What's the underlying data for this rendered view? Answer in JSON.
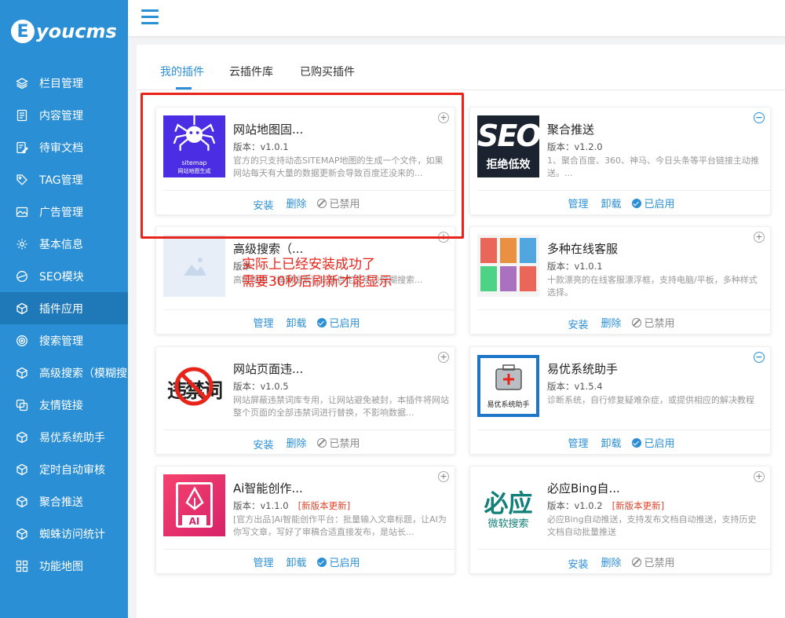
{
  "logo": {
    "letter": "E",
    "text": "youcms"
  },
  "sidebar": {
    "items": [
      {
        "label": "栏目管理",
        "icon": "layers-icon"
      },
      {
        "label": "内容管理",
        "icon": "document-icon"
      },
      {
        "label": "待审文档",
        "icon": "edit-document-icon"
      },
      {
        "label": "TAG管理",
        "icon": "tag-icon"
      },
      {
        "label": "广告管理",
        "icon": "image-icon"
      },
      {
        "label": "基本信息",
        "icon": "gear-icon"
      },
      {
        "label": "SEO模块",
        "icon": "globe-icon"
      },
      {
        "label": "插件应用",
        "icon": "cube-icon"
      },
      {
        "label": "搜索管理",
        "icon": "target-icon"
      },
      {
        "label": "高级搜索（模糊搜",
        "icon": "cube-icon"
      },
      {
        "label": "友情链接",
        "icon": "link-icon"
      },
      {
        "label": "易优系统助手",
        "icon": "cube-icon"
      },
      {
        "label": "定时自动审核",
        "icon": "cube-icon"
      },
      {
        "label": "聚合推送",
        "icon": "cube-icon"
      },
      {
        "label": "蜘蛛访问统计",
        "icon": "cube-icon"
      },
      {
        "label": "功能地图",
        "icon": "grid-icon"
      }
    ],
    "active_index": 7
  },
  "tabs": [
    "我的插件",
    "云插件库",
    "已购买插件"
  ],
  "labels": {
    "install": "安装",
    "delete": "删除",
    "disabled": "已禁用",
    "manage": "管理",
    "uninstall": "卸载",
    "enabled": "已启用"
  },
  "plugins": [
    {
      "name": "网站地图固...",
      "version": "版本：v1.0.1",
      "desc": "官方的只支持动态SITEMAP地图的生成一个文件，如果网站每天有大量的数据更新会导致百度还没来的...",
      "installed": false,
      "toggle": "+",
      "icon_text": [
        "sitemap",
        "网站地图生成"
      ]
    },
    {
      "name": "聚合推送",
      "version": "版本：v1.2.0",
      "desc": "1、聚合百度、360、神马、今日头条等平台链接主动推送。...",
      "installed": true,
      "toggle": "−",
      "icon_text": [
        "SEO",
        "拒绝低效"
      ]
    },
    {
      "name": "高级搜索（...",
      "version": "版本：",
      "desc": "高级搜索（模糊搜索）支持自定义字段模糊搜索...",
      "installed": true,
      "toggle": "+"
    },
    {
      "name": "多种在线客服",
      "version": "版本：v1.0.1",
      "desc": "十款漂亮的在线客服漂浮框，支持电脑/平板，多种样式选择。",
      "installed": false,
      "toggle": "+"
    },
    {
      "name": "网站页面违...",
      "version": "版本：v1.0.5",
      "desc": "网站屏蔽违禁词库专用，让网站避免被封，本插件将网站整个页面的全部违禁词进行替换，不影响数据...",
      "installed": false,
      "toggle": "+",
      "icon_text": [
        "违禁词"
      ]
    },
    {
      "name": "易优系统助手",
      "version": "版本：v1.5.4",
      "desc": "诊断系统，自行修复疑难杂症，或提供相应的解决教程",
      "installed": true,
      "toggle": "−",
      "icon_text": [
        "易优系统助手"
      ]
    },
    {
      "name": "Ai智能创作...",
      "version": "版本：v1.1.0",
      "update": "[新版本更新]",
      "desc": "[官方出品]Ai智能创作平台：批量输入文章标题，让AI为你写文章，写好了审稿合适直接发布，是站长...",
      "installed": true,
      "toggle": "+",
      "icon_text": [
        "AI"
      ]
    },
    {
      "name": "必应Bing自...",
      "version": "版本：v1.0.2",
      "update": "[新版本更新]",
      "desc": "必应Bing自动推送，支持发布文档自动推送，支持历史文档自动批量推送",
      "installed": false,
      "toggle": "+",
      "icon_text": [
        "必应",
        "微软搜索"
      ]
    }
  ],
  "annotation": {
    "line1": "实际上已经安装成功了",
    "line2": "需要30秒后刷新才能显示"
  },
  "colors": {
    "sidebar": "#2b8fd5",
    "accent": "#2b8fd5",
    "annotation": "#e8231a"
  }
}
